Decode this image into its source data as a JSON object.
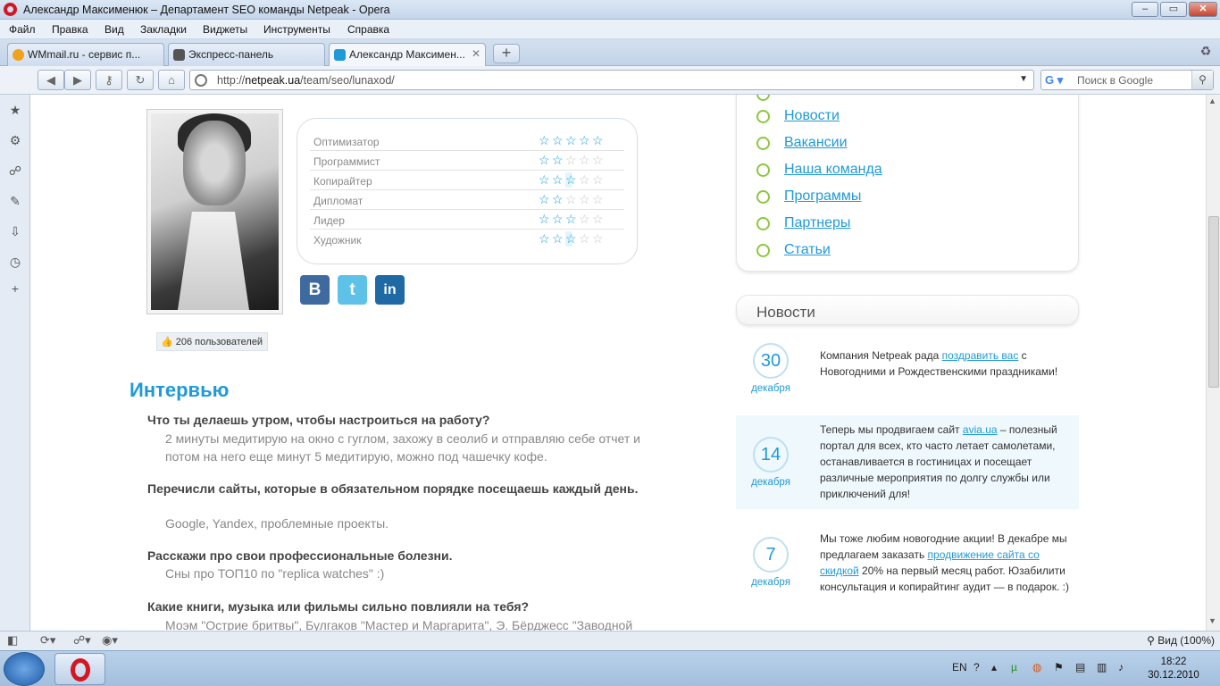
{
  "window": {
    "title": "Александр Максименюк – Департамент SEO команды Netpeak - Opera"
  },
  "menu": [
    "Файл",
    "Правка",
    "Вид",
    "Закладки",
    "Виджеты",
    "Инструменты",
    "Справка"
  ],
  "tabs": [
    {
      "label": "WMmail.ru - сервис п..."
    },
    {
      "label": "Экспресс-панель"
    },
    {
      "label": "Александр Максимен..."
    }
  ],
  "address": {
    "prefix": "http://",
    "host": "netpeak.ua",
    "path": "/team/seo/lunaxod/"
  },
  "search": {
    "placeholder": "Поиск в Google"
  },
  "skills": [
    {
      "label": "Оптимизатор",
      "stars": 5
    },
    {
      "label": "Программист",
      "stars": 2
    },
    {
      "label": "Копирайтер",
      "stars": 2.5
    },
    {
      "label": "Дипломат",
      "stars": 2
    },
    {
      "label": "Лидер",
      "stars": 3
    },
    {
      "label": "Художник",
      "stars": 2.5
    }
  ],
  "social": {
    "vk": "В",
    "twitter": "t",
    "linkedin": "in"
  },
  "likes": "206 пользователей",
  "interview": {
    "heading": "Интервью",
    "items": [
      {
        "q": "Что ты делаешь утром, чтобы настроиться на работу?",
        "a": "2 минуты медитирую на окно с гуглом, захожу в сеолиб и отправляю себе отчет и потом на него еще минут 5 медитирую, можно под чашечку кофе."
      },
      {
        "q": "Перечисли сайты, которые в обязательном порядке посещаешь каждый день.",
        "a": "Google, Yandex, проблемные проекты."
      },
      {
        "q": "Расскажи про свои профессиональные болезни.",
        "a": "Сны про ТОП10 по \"replica watches\" :)"
      },
      {
        "q": "Какие книги, музыка или фильмы сильно повлияли на тебя?",
        "a": "Моэм \"Острие бритвы\", Булгаков \"Мастер и Маргарита\", Э. Бёрджесс \"Заводной"
      }
    ]
  },
  "sidebar_menu": [
    "Новости",
    "Вакансии",
    "Наша команда",
    "Программы",
    "Партнеры",
    "Статьи"
  ],
  "news": {
    "heading": "Новости",
    "items": [
      {
        "day": "30",
        "month": "декабря",
        "pre": "Компания Netpeak рада ",
        "link": "поздравить вас",
        "post": " с Новогодними и Рождественскими праздниками!"
      },
      {
        "day": "14",
        "month": "декабря",
        "pre": "Теперь мы продвигаем сайт ",
        "link": "avia.ua",
        "post": " – полезный портал для всех, кто часто летает самолетами, останавливается в гостиницах и посещает различные мероприятия по долгу службы или приключений для!"
      },
      {
        "day": "7",
        "month": "декабря",
        "pre": "Мы тоже любим новогодние акции! В декабре мы предлагаем заказать ",
        "link": "продвижение сайта со скидкой",
        "post": " 20% на первый месяц работ. Юзабилити консультация и копирайтинг аудит — в подарок. :)"
      }
    ]
  },
  "status": {
    "zoom": "Вид (100%)"
  },
  "taskbar": {
    "lang": "EN",
    "time": "18:22",
    "date": "30.12.2010"
  },
  "colors": {
    "accent": "#1f9ad6",
    "bullet": "#8dc63f",
    "vk": "#3e6aa0",
    "twitter": "#5ec2e8",
    "linkedin": "#1f6aa5"
  }
}
